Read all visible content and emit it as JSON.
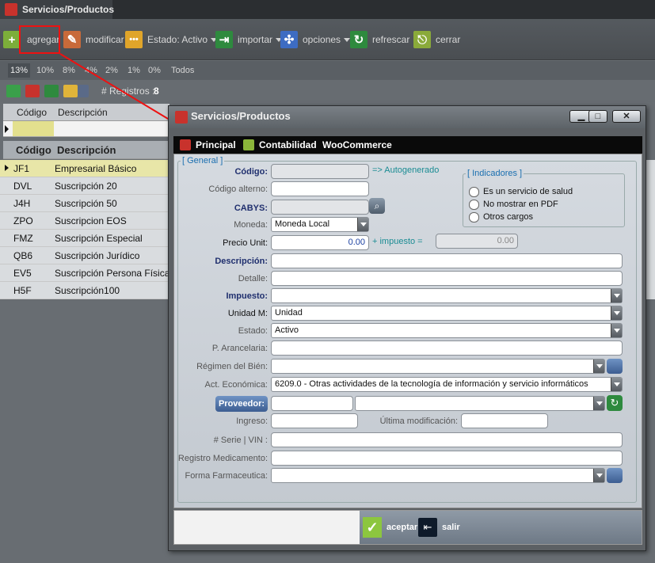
{
  "window": {
    "title": "Servicios/Productos"
  },
  "toolbar": {
    "agregar": "agregar",
    "modificar": "modificar",
    "estado": "Estado: Activo",
    "importar": "importar",
    "opciones": "opciones",
    "refrescar": "refrescar",
    "cerrar": "cerrar"
  },
  "percent_filters": [
    "13%",
    "10%",
    "8%",
    "4%",
    "2%",
    "1%",
    "0%",
    "Todos"
  ],
  "registros": {
    "label": "# Registros :",
    "count": "8"
  },
  "grid": {
    "col_codigo": "Código",
    "col_descripcion": "Descripción",
    "rows": [
      {
        "code": "JF1",
        "desc": "Empresarial Básico"
      },
      {
        "code": "DVL",
        "desc": "Suscripción 20"
      },
      {
        "code": "J4H",
        "desc": "Suscripción 50"
      },
      {
        "code": "ZPO",
        "desc": "Suscripcion EOS"
      },
      {
        "code": "FMZ",
        "desc": "Suscripción Especial"
      },
      {
        "code": "QB6",
        "desc": "Suscripción Jurídico"
      },
      {
        "code": "EV5",
        "desc": "Suscripción Persona Física"
      },
      {
        "code": "H5F",
        "desc": "Suscripción100"
      }
    ]
  },
  "dialog": {
    "title": "Servicios/Productos",
    "tabs": {
      "principal": "Principal",
      "contabilidad": "Contabilidad",
      "woocommerce": "WooCommerce"
    },
    "group_general": "[ General ]",
    "group_indicadores": "[ Indicadores ]",
    "indicadores": [
      "Es un servicio de salud",
      "No mostrar en PDF",
      "Otros cargos"
    ],
    "labels": {
      "codigo": "Código:",
      "autogenerado": "=> Autogenerado",
      "codigo_alterno": "Código alterno:",
      "cabys": "CABYS:",
      "moneda": "Moneda:",
      "precio_unit": "Precio Unit:",
      "mas_impuesto": "+ impuesto =",
      "descripcion": "Descripción:",
      "detalle": "Detalle:",
      "impuesto": "Impuesto:",
      "unidad_m": "Unidad M:",
      "estado": "Estado:",
      "p_arancelaria": "P. Arancelaria:",
      "regimen": "Régimen del Bién:",
      "act_economica": "Act. Económica:",
      "proveedor": "Proveedor:",
      "ingreso": "Ingreso:",
      "ultima_mod": "Última modificación:",
      "serie_vin": "# Serie | VIN :",
      "registro_medicamento": "Registro Medicamento:",
      "forma_farmaceutica": "Forma Farmaceutica:"
    },
    "values": {
      "moneda": "Moneda Local",
      "precio_unit": "0.00",
      "precio_total": "0.00",
      "unidad_m": "Unidad",
      "estado": "Activo",
      "act_economica": "6209.0 - Otras actividades de la tecnología de información y servicio informáticos"
    },
    "buttons": {
      "aceptar": "aceptar",
      "salir": "salir"
    }
  },
  "colors": {
    "highlight": "#e11",
    "accent_green": "#2a9d3a",
    "accent_blue": "#1f2f6e"
  }
}
